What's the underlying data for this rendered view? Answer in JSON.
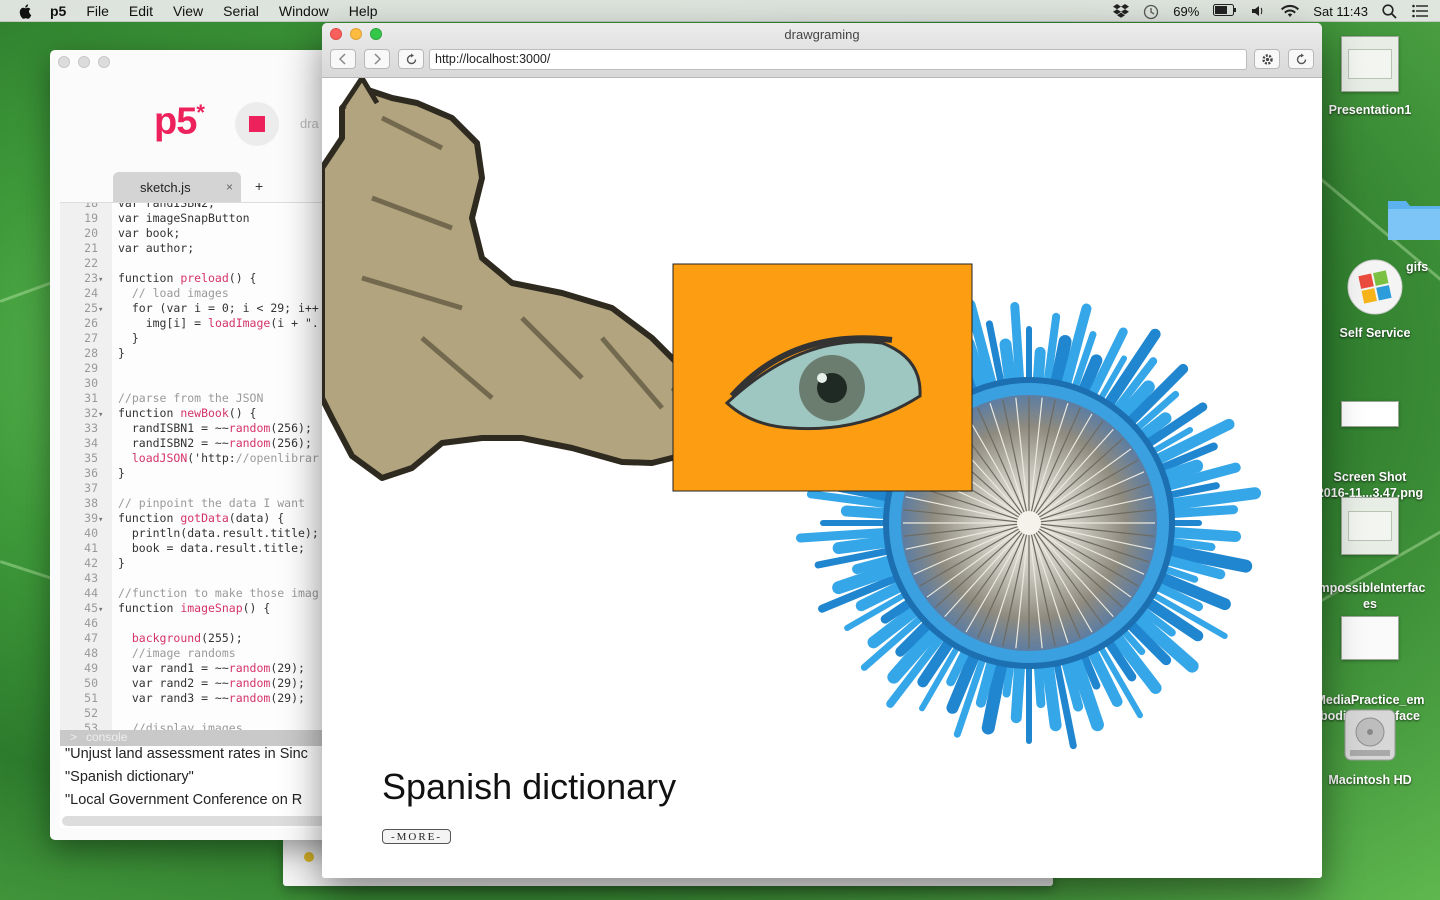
{
  "menubar": {
    "app": "p5",
    "items": [
      "File",
      "Edit",
      "View",
      "Serial",
      "Window",
      "Help"
    ],
    "battery": "69%",
    "clock": "Sat 11:43"
  },
  "editor": {
    "logo": "p5",
    "logo_star": "*",
    "sketch_name": "dra",
    "tab_label": "sketch.js",
    "tab_close": "×",
    "add_tab": "+",
    "code_lines": [
      {
        "n": "18",
        "fold": "",
        "t": "var randISBN2;"
      },
      {
        "n": "19",
        "fold": "",
        "t": "var imageSnapButton"
      },
      {
        "n": "20",
        "fold": "",
        "t": "var book;"
      },
      {
        "n": "21",
        "fold": "",
        "t": "var author;"
      },
      {
        "n": "22",
        "fold": "",
        "t": ""
      },
      {
        "n": "23",
        "fold": "▾",
        "t": "function preload() {"
      },
      {
        "n": "24",
        "fold": "",
        "t": "  // load images"
      },
      {
        "n": "25",
        "fold": "▾",
        "t": "  for (var i = 0; i < 29; i++"
      },
      {
        "n": "26",
        "fold": "",
        "t": "    img[i] = loadImage(i + \"."
      },
      {
        "n": "27",
        "fold": "",
        "t": "  }"
      },
      {
        "n": "28",
        "fold": "",
        "t": "}"
      },
      {
        "n": "29",
        "fold": "",
        "t": ""
      },
      {
        "n": "30",
        "fold": "",
        "t": ""
      },
      {
        "n": "31",
        "fold": "",
        "t": "//parse from the JSON"
      },
      {
        "n": "32",
        "fold": "▾",
        "t": "function newBook() {"
      },
      {
        "n": "33",
        "fold": "",
        "t": "  randISBN1 = ~~random(256);"
      },
      {
        "n": "34",
        "fold": "",
        "t": "  randISBN2 = ~~random(256);"
      },
      {
        "n": "35",
        "fold": "",
        "t": "  loadJSON('http://openlibrar"
      },
      {
        "n": "36",
        "fold": "",
        "t": "}"
      },
      {
        "n": "37",
        "fold": "",
        "t": ""
      },
      {
        "n": "38",
        "fold": "",
        "t": "// pinpoint the data I want"
      },
      {
        "n": "39",
        "fold": "▾",
        "t": "function gotData(data) {"
      },
      {
        "n": "40",
        "fold": "",
        "t": "  println(data.result.title);"
      },
      {
        "n": "41",
        "fold": "",
        "t": "  book = data.result.title;"
      },
      {
        "n": "42",
        "fold": "",
        "t": "}"
      },
      {
        "n": "43",
        "fold": "",
        "t": ""
      },
      {
        "n": "44",
        "fold": "",
        "t": "//function to make those imag"
      },
      {
        "n": "45",
        "fold": "▾",
        "t": "function imageSnap() {"
      },
      {
        "n": "46",
        "fold": "",
        "t": ""
      },
      {
        "n": "47",
        "fold": "",
        "t": "  background(255);"
      },
      {
        "n": "48",
        "fold": "",
        "t": "  //image randoms"
      },
      {
        "n": "49",
        "fold": "",
        "t": "  var rand1 = ~~random(29);"
      },
      {
        "n": "50",
        "fold": "",
        "t": "  var rand2 = ~~random(29);"
      },
      {
        "n": "51",
        "fold": "",
        "t": "  var rand3 = ~~random(29);"
      },
      {
        "n": "52",
        "fold": "",
        "t": ""
      },
      {
        "n": "53",
        "fold": "",
        "t": "  //display images"
      }
    ],
    "console_label": "console",
    "console_arrow": ">",
    "console_lines": [
      "\"Unjust land assessment rates in Sinc",
      "\"Spanish dictionary\"",
      "\"Local Government Conference on R"
    ]
  },
  "browser": {
    "window_title": "drawgraming",
    "url": "http://localhost:3000/",
    "book_title": "Spanish dictionary",
    "more_label": "-MORE-"
  },
  "desktop": {
    "icons": [
      {
        "label": "Presentation1"
      },
      {
        "label": "gifs"
      },
      {
        "label": "Self Service"
      },
      {
        "label": "Screen Shot\n2016-11...3.47.png"
      },
      {
        "label": "ImpossibleInterfac\nes"
      },
      {
        "label": "MediaPractice_em\nbodied_Interface"
      },
      {
        "label": "Macintosh HD"
      }
    ]
  }
}
